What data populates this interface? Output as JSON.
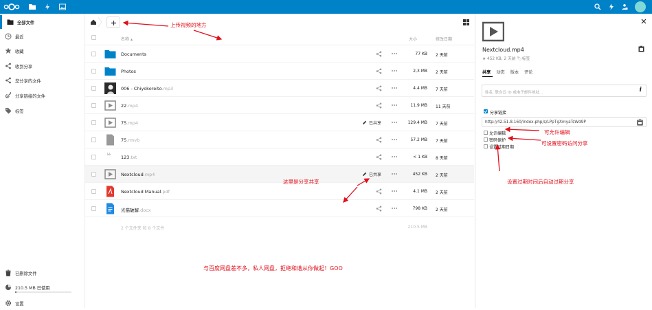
{
  "header": {
    "app_icons": [
      "files-icon",
      "activity-icon",
      "gallery-icon"
    ],
    "right_icons": [
      "search-icon",
      "notifications-icon",
      "user-status-icon",
      "contacts-icon"
    ],
    "brand_color": "#0082c9"
  },
  "sidebar": {
    "items": [
      {
        "label": "全部文件",
        "icon": "folder-icon"
      },
      {
        "label": "最近",
        "icon": "clock-icon"
      },
      {
        "label": "收藏",
        "icon": "star-icon"
      },
      {
        "label": "收到分享",
        "icon": "share-icon"
      },
      {
        "label": "您分享的文件",
        "icon": "share-icon"
      },
      {
        "label": "分享链接的文件",
        "icon": "link-icon"
      },
      {
        "label": "标签",
        "icon": "tag-icon"
      }
    ],
    "bottom": {
      "deleted": "已删除文件",
      "quota": "210.5 MB 已使用",
      "quota_fraction": 0.02,
      "settings": "设置"
    }
  },
  "list": {
    "headers": {
      "name": "名称",
      "size": "大小",
      "modified": "修改日期"
    },
    "files": [
      {
        "base": "Documents",
        "ext": "",
        "type": "folder",
        "size": "77 KB",
        "date": "2 天前",
        "shared": ""
      },
      {
        "base": "Photos",
        "ext": "",
        "type": "folder",
        "size": "2,3 MB",
        "date": "2 天前",
        "shared": ""
      },
      {
        "base": "006 - Chiyokoreito",
        "ext": ".mp3",
        "type": "audio",
        "size": "4.4 MB",
        "date": "7 天前",
        "shared": ""
      },
      {
        "base": "22",
        "ext": ".mp4",
        "type": "video",
        "size": "11.9 MB",
        "date": "11 天前",
        "shared": ""
      },
      {
        "base": "75",
        "ext": ".mp4",
        "type": "video",
        "size": "129.4 MB",
        "date": "7 天前",
        "shared": "已共享"
      },
      {
        "base": "75",
        "ext": ".rmvb",
        "type": "file",
        "size": "57.2 MB",
        "date": "7 天前",
        "shared": ""
      },
      {
        "base": "123",
        "ext": ".txt",
        "type": "text",
        "size": "< 1 KB",
        "date": "8 天前",
        "shared": ""
      },
      {
        "base": "Nextcloud",
        "ext": ".mp4",
        "type": "video",
        "size": "452 KB",
        "date": "2 天前",
        "shared": "已共享"
      },
      {
        "base": "Nextcloud Manual",
        "ext": ".pdf",
        "type": "pdf",
        "size": "4.1 MB",
        "date": "2 天前",
        "shared": ""
      },
      {
        "base": "光猫破解",
        "ext": ".docx",
        "type": "doc",
        "size": "798 KB",
        "date": "2 天前",
        "shared": ""
      }
    ],
    "summary": "2 个文件夹 和 8 个文件",
    "summary_size": "210.5 MB"
  },
  "details": {
    "filename": "Nextcloud.mp4",
    "meta": "452 KB, 2 天前",
    "tag": "标签",
    "tabs": [
      "共享",
      "动态",
      "版本",
      "评论"
    ],
    "share_placeholder": "姓名, 联合云 ID 或电子邮件地址...",
    "share_link_label": "分享链接",
    "share_url": "http://42.51.8.160/index.php/s/LPpTgXmyaTsWd9P",
    "options": [
      "允许编辑",
      "密码保护",
      "设置过期日期"
    ]
  },
  "annotations": {
    "upload": "上传视频的地方",
    "share": "这里是分享共享",
    "edit": "可允许编辑",
    "password": "可设置密码访问分享",
    "expiry": "设置过期时间后自动过期分享",
    "footer": "与百度网盘差不多，私人网盘，拒绝和谐从你做起！GOO",
    "color": "#e0101c"
  }
}
